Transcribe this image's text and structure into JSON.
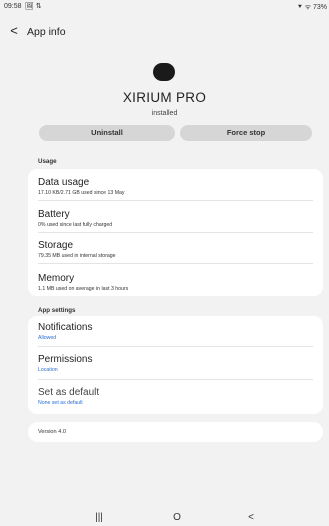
{
  "status_bar": {
    "time": "09:58",
    "left_icons": "🖼 ⇅",
    "right_text": "⯆ ᯤ 73%"
  },
  "app_bar": {
    "back_label": "<",
    "title": "App info"
  },
  "app": {
    "name": "XIRIUM PRO",
    "status": "installed"
  },
  "actions": {
    "uninstall": "Uninstall",
    "force_stop": "Force stop"
  },
  "usage": {
    "header": "Usage",
    "items": [
      {
        "title": "Data usage",
        "subtitle": "17.10 KB/2.71 GB used since 13 May"
      },
      {
        "title": "Battery",
        "subtitle": "0% used since last fully charged"
      },
      {
        "title": "Storage",
        "subtitle": "79.35 MB used in internal storage"
      },
      {
        "title": "Memory",
        "subtitle": "1.1 MB used on average in last 3 hours"
      }
    ]
  },
  "app_settings": {
    "header": "App settings",
    "items": [
      {
        "title": "Notifications",
        "subtitle": "Allowed"
      },
      {
        "title": "Permissions",
        "subtitle": "Location"
      },
      {
        "title": "Set as default",
        "subtitle": "None set as default"
      }
    ]
  },
  "version": "Version 4.0",
  "nav": {
    "recents": "|||",
    "home": "O",
    "back": "<"
  },
  "colors": {
    "background": "#f2f2f2",
    "card": "#ffffff",
    "button": "#d6d6d6",
    "accent_blue": "#2c6fd6"
  }
}
